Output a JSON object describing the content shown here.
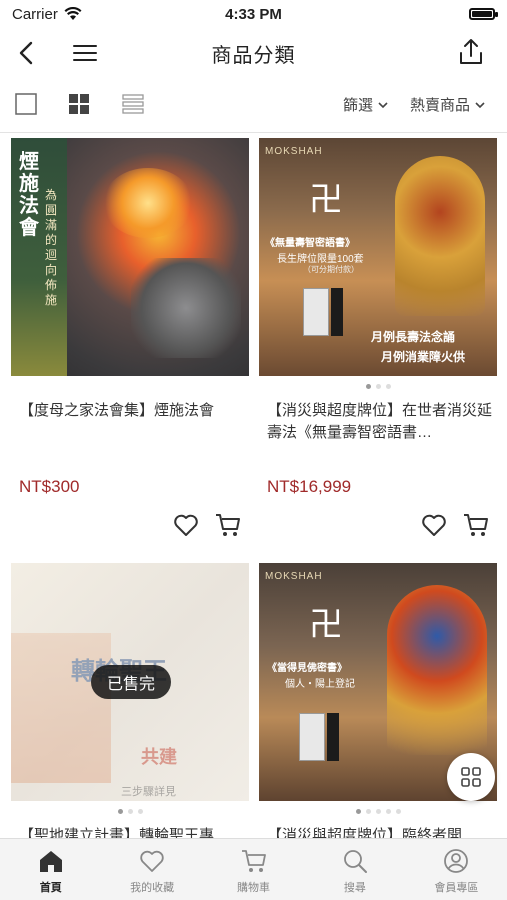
{
  "status": {
    "carrier": "Carrier",
    "time": "4:33 PM"
  },
  "nav": {
    "title": "商品分類"
  },
  "toolbar": {
    "filter_label": "篩選",
    "sort_label": "熱賣商品"
  },
  "products": [
    {
      "name": "【度母之家法會集】煙施法會",
      "price": "NT$300",
      "image": {
        "headline": "煙施法會",
        "caption": "為圓滿的迴向佈施"
      },
      "dots": 1,
      "sold_out": false
    },
    {
      "name": "【消災與超度牌位】在世者消災延壽法《無量壽智密語書…",
      "price": "NT$16,999",
      "image": {
        "brand": "MOKSHAH",
        "headline": "《無量壽智密語書》",
        "sub": "長生牌位限量100套",
        "note": "（可分期付款）",
        "line1": "月例長壽法念誦",
        "line2": "月例消業障火供"
      },
      "dots": 3,
      "sold_out": false
    },
    {
      "name": "【聖地建立計畫】轉輪聖王專",
      "price": "",
      "image": {
        "banner": "轉輪聖王",
        "tag": "共建",
        "footer": "三步驟詳見"
      },
      "dots": 3,
      "sold_out": true
    },
    {
      "name": "【消災與超度牌位】臨終者開",
      "price": "",
      "image": {
        "brand": "MOKSHAH",
        "headline": "《當得見佛密書》",
        "sub": "個人・陽上登記"
      },
      "dots": 5,
      "sold_out": false
    }
  ],
  "sold_out_label": "已售完",
  "tabs": [
    {
      "label": "首頁",
      "icon": "home-icon",
      "active": true
    },
    {
      "label": "我的收藏",
      "icon": "heart-icon",
      "active": false
    },
    {
      "label": "購物車",
      "icon": "cart-icon",
      "active": false
    },
    {
      "label": "搜尋",
      "icon": "search-icon",
      "active": false
    },
    {
      "label": "會員專區",
      "icon": "user-icon",
      "active": false
    }
  ],
  "colors": {
    "price": "#a02a2a",
    "accent": "#222222"
  }
}
